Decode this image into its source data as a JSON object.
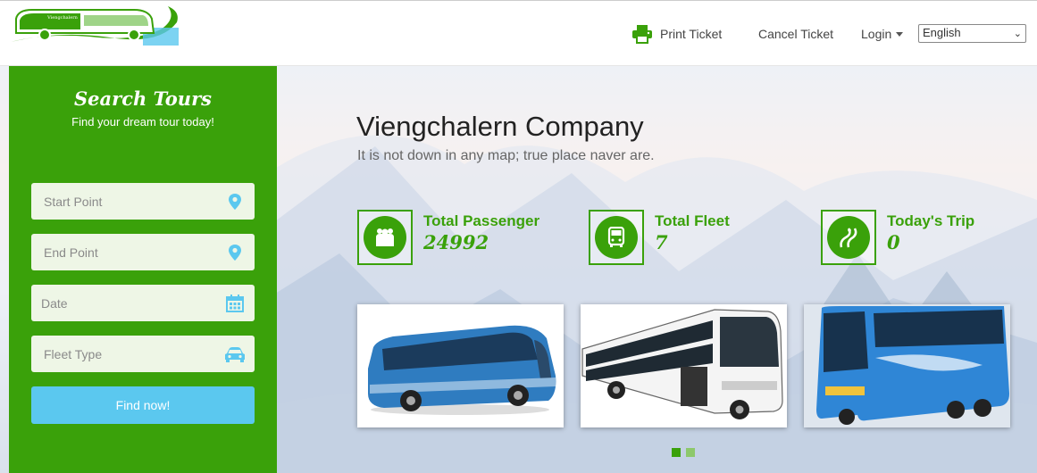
{
  "header": {
    "logo_text": "Viengchalern",
    "nav": {
      "print_ticket": "Print Ticket",
      "cancel_ticket": "Cancel Ticket",
      "login": "Login"
    },
    "language": "English"
  },
  "search": {
    "title": "Search Tours",
    "subtitle": "Find your dream tour today!",
    "start_placeholder": "Start Point",
    "end_placeholder": "End Point",
    "date_placeholder": "Date",
    "fleet_placeholder": "Fleet Type",
    "button": "Find now!"
  },
  "hero": {
    "company": "Viengchalern Company",
    "tagline": "It is not down in any map; true place naver are."
  },
  "stats": [
    {
      "label": "Total Passenger",
      "value": "24992",
      "icon": "passenger-icon"
    },
    {
      "label": "Total Fleet",
      "value": "7",
      "icon": "bus-icon"
    },
    {
      "label": "Today's Trip",
      "value": "0",
      "icon": "road-icon"
    }
  ],
  "gallery": {
    "images": [
      "blue-coach-bus",
      "white-double-deck-bus",
      "blue-painted-bus"
    ],
    "active_slide": 1,
    "slides": 2
  },
  "colors": {
    "brand_green": "#3aa10a",
    "button_blue": "#5bc8ef",
    "field_bg": "#eef6e6"
  }
}
